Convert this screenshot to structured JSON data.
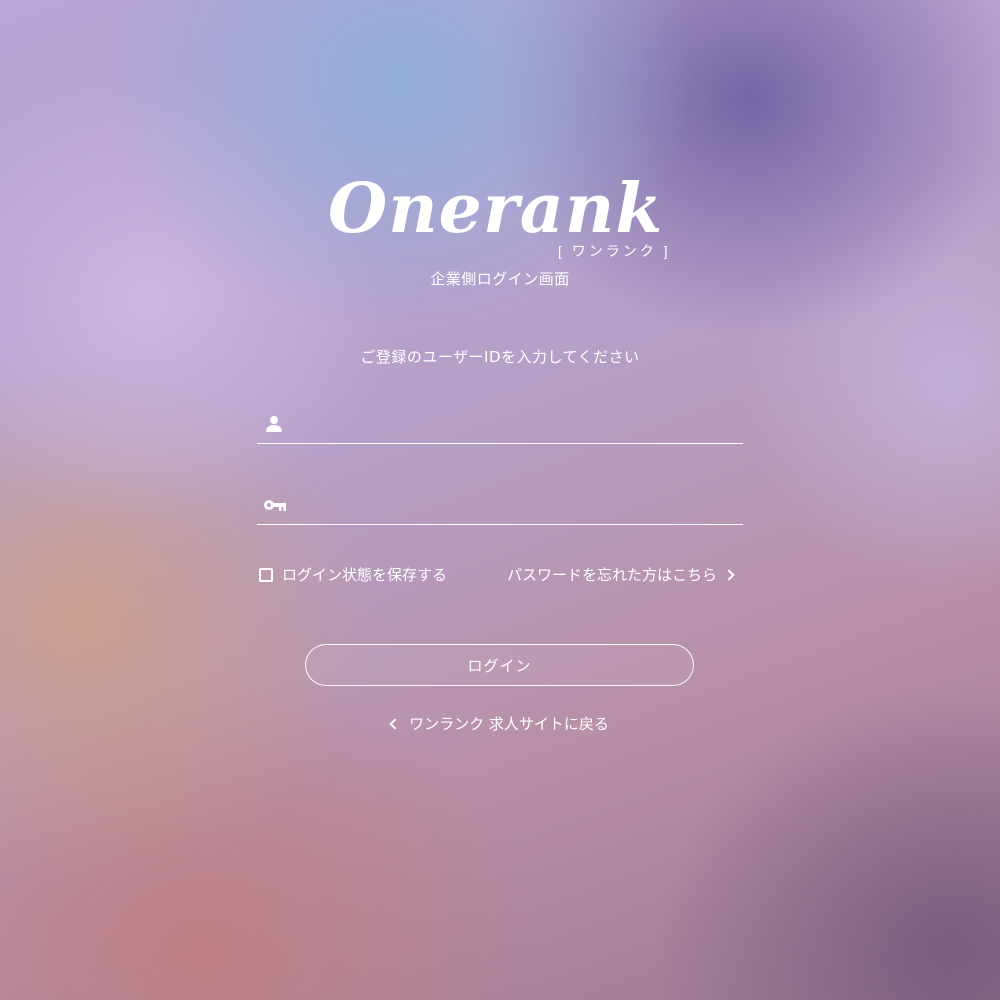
{
  "brand": {
    "logo_text": "Onerank",
    "logo_kana": "[ ワンランク ]"
  },
  "subtitle": "企業側ログイン画面",
  "instruction": "ご登録のユーザーIDを入力してください",
  "form": {
    "user_field": {
      "icon": "user-icon",
      "value": "",
      "placeholder": ""
    },
    "password_field": {
      "icon": "key-icon",
      "value": "",
      "placeholder": ""
    },
    "remember_label": "ログイン状態を保存する",
    "remember_checked": false,
    "forgot_label": "パスワードを忘れた方はこちら",
    "login_label": "ログイン"
  },
  "back_link_label": "ワンランク 求人サイトに戻る",
  "colors": {
    "text": "#ffffff"
  }
}
